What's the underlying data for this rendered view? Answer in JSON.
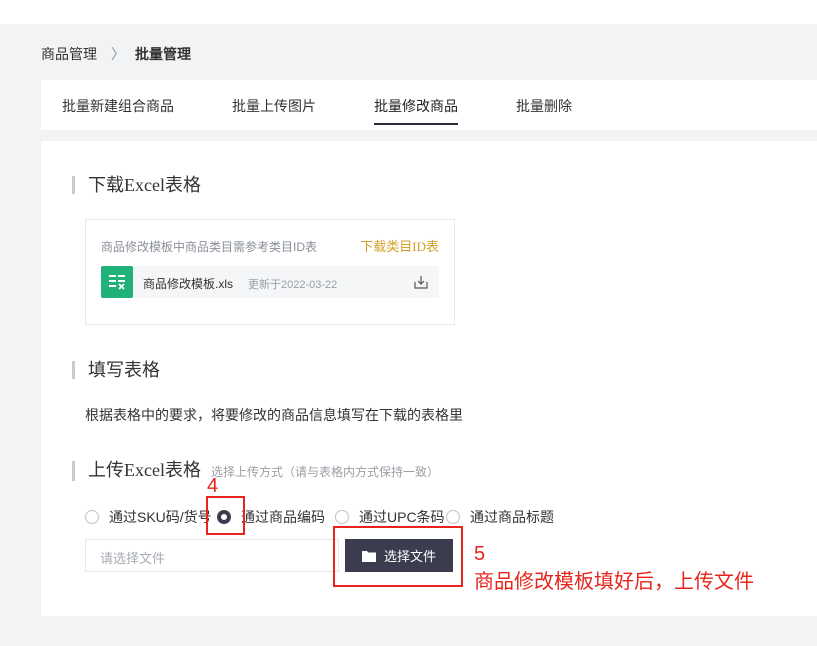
{
  "breadcrumb": {
    "root": "商品管理",
    "sep": "〉",
    "current": "批量管理"
  },
  "tabs": [
    {
      "label": "批量新建组合商品",
      "active": false
    },
    {
      "label": "批量上传图片",
      "active": false
    },
    {
      "label": "批量修改商品",
      "active": true
    },
    {
      "label": "批量删除",
      "active": false
    }
  ],
  "section_download": {
    "title": "下载Excel表格",
    "hint": "商品修改模板中商品类目需参考类目ID表",
    "link": "下载类目ID表",
    "file": {
      "name": "商品修改模板.xls",
      "updated": "更新于2022-03-22",
      "icon": "xls-file-icon"
    }
  },
  "section_fill": {
    "title": "填写表格",
    "desc": "根据表格中的要求，将要修改的商品信息填写在下载的表格里"
  },
  "section_upload": {
    "title": "上传Excel表格",
    "subtitle": "选择上传方式（请与表格内方式保持一致）",
    "options": [
      {
        "label": "通过SKU码/货号",
        "checked": false
      },
      {
        "label": "通过商品编码",
        "checked": true
      },
      {
        "label": "通过UPC条码",
        "checked": false
      },
      {
        "label": "通过商品标题",
        "checked": false
      }
    ],
    "file_placeholder": "请选择文件",
    "choose_button": "选择文件"
  },
  "annotations": {
    "step4": "4",
    "step5": "5",
    "step5_note": "商品修改模板填好后，上传文件",
    "color": "#e8251d"
  },
  "colors": {
    "accent": "#3b3d4e",
    "link": "#d4a02a",
    "excel": "#1fb178"
  }
}
